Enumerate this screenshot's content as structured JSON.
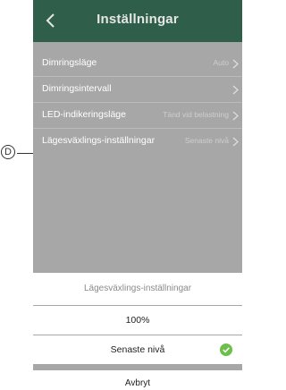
{
  "header": {
    "title": "Inställningar"
  },
  "settings": [
    {
      "label": "Dimringsläge",
      "value": "Auto"
    },
    {
      "label": "Dimringsintervall",
      "value": ""
    },
    {
      "label": "LED-indikeringsläge",
      "value": "Tänd vid belastning"
    },
    {
      "label": "Lägesväxlings-inställningar",
      "value": "Senaste nivå"
    }
  ],
  "callout": {
    "letter": "D"
  },
  "sheet": {
    "title": "Lägesväxlings-inställningar",
    "options": [
      {
        "label": "100%",
        "selected": false
      },
      {
        "label": "Senaste nivå",
        "selected": true
      }
    ],
    "cancel": "Avbryt"
  },
  "colors": {
    "header": "#2f5f4a",
    "overlay": "#a7a7a7",
    "check": "#6cbf4a"
  }
}
